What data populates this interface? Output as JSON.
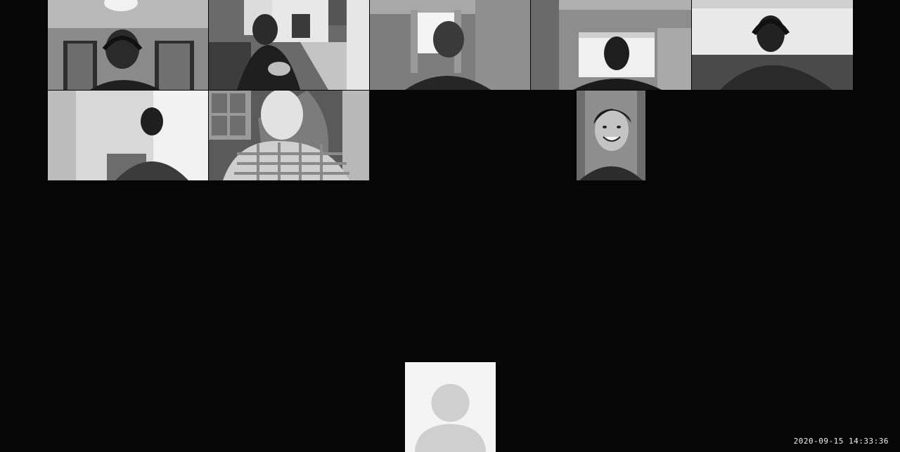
{
  "app": {
    "view": "gallery",
    "theme": {
      "background": "#060606",
      "tile_tone": "grayscale"
    }
  },
  "participants": [
    {
      "slot": 1,
      "video": "on",
      "scene": "person with headphones in front of a window"
    },
    {
      "slot": 2,
      "video": "on",
      "scene": "person gesturing in a living room"
    },
    {
      "slot": 3,
      "video": "on",
      "scene": "person in front of a bright window"
    },
    {
      "slot": 4,
      "video": "on",
      "scene": "person in front of a window"
    },
    {
      "slot": 5,
      "video": "on",
      "scene": "person with headphones, bright background"
    },
    {
      "slot": 6,
      "video": "on",
      "scene": "person in a room with a bright wall"
    },
    {
      "slot": 7,
      "video": "on",
      "scene": "person in a plaid shirt, close to camera"
    },
    {
      "slot": 8,
      "video": "on",
      "scene": "smiling person, narrow portrait tile"
    }
  ],
  "self_view": {
    "video": "off",
    "icon": "user-avatar-placeholder-icon"
  },
  "recording": {
    "timestamp": "2020-09-15  14:33:36"
  }
}
